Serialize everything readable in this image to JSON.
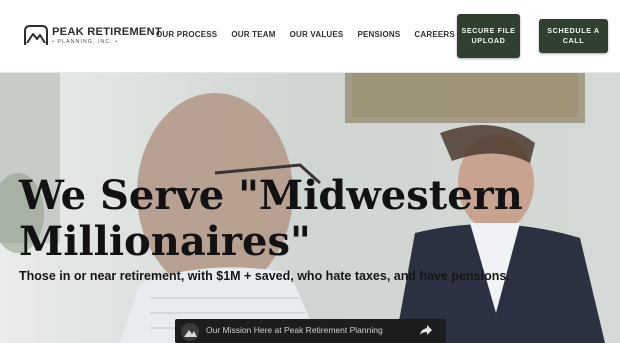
{
  "header": {
    "logo": {
      "title": "PEAK RETIREMENT",
      "subtitle": "• PLANNING, INC. •"
    },
    "nav": [
      "OUR PROCESS",
      "OUR TEAM",
      "OUR VALUES",
      "PENSIONS",
      "CAREERS"
    ],
    "buttons": {
      "secure": "SECURE FILE UPLOAD",
      "schedule": "SCHEDULE A CALL"
    }
  },
  "hero": {
    "headline": "We Serve \"Midwestern Millionaires\"",
    "subline": "Those in or near retirement, with $1M + saved, who hate taxes, and have pensions.",
    "video": {
      "title": "Our Mission Here at Peak Retirement Planning"
    }
  },
  "colors": {
    "brand_green": "#2f4030",
    "text_dark": "#121212"
  },
  "icons": [
    "mountain-logo-icon",
    "share-icon",
    "video-channel-avatar"
  ]
}
